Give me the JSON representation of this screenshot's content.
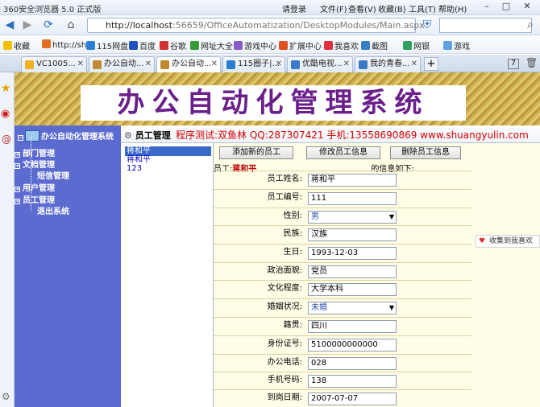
{
  "browser": {
    "title": "360安全浏览器 5.0 正式版",
    "login": "请登录",
    "menus": [
      "文件(F)",
      "查看(V)",
      "收藏(B)",
      "工具(T)",
      "帮助(H)"
    ],
    "url_host": "http://localhost",
    "url_rest": ":56659/OfficeAutomatization/DesktopModules/Main.aspx",
    "bookmarks": [
      "收藏",
      "http://sh",
      "115网盘",
      "百度",
      "谷歌",
      "网址大全",
      "游戏中心",
      "扩展中心",
      "我喜欢",
      "截图",
      "网银",
      "游戏"
    ],
    "tabs": [
      "VC1005...",
      "办公自动...",
      "办公自动...",
      "115圈子|...",
      "优酷电视...",
      "我的青春..."
    ],
    "active_tab": 2,
    "new_tab": "+",
    "tab_count": "7",
    "fav_tip": "收集到我喜欢"
  },
  "banner": {
    "title": "办公自动化管理系统"
  },
  "nav": {
    "root": "办公自动化管理系统",
    "items": [
      {
        "label": "部门管理",
        "expand": "+"
      },
      {
        "label": "文档管理",
        "expand": "+"
      },
      {
        "label": "短信管理",
        "expand": ""
      },
      {
        "label": "用户管理",
        "expand": "+"
      },
      {
        "label": "员工管理",
        "expand": "+"
      },
      {
        "label": "退出系统",
        "expand": ""
      }
    ]
  },
  "header": {
    "section": "员工管理",
    "promo": "程序测试:双鱼林 QQ:287307421 手机:13558690869 www.shuangyulin.com"
  },
  "employees": [
    "蒋和平",
    "蒋和平",
    "123"
  ],
  "selected_employee": 0,
  "actions": {
    "add": "添加新的员工",
    "edit": "修改员工信息",
    "delete": "删除员工信息"
  },
  "caption": {
    "prefix": "员工:",
    "name": "蒋和平",
    "suffix": "的信息如下:"
  },
  "form": [
    {
      "label": "员工姓名:",
      "value": "蒋和平",
      "type": "text"
    },
    {
      "label": "员工编号:",
      "value": "111",
      "type": "text"
    },
    {
      "label": "性别:",
      "value": "男",
      "type": "select"
    },
    {
      "label": "民族:",
      "value": "汉族",
      "type": "text"
    },
    {
      "label": "生日:",
      "value": "1993-12-03",
      "type": "text"
    },
    {
      "label": "政治面貌:",
      "value": "党员",
      "type": "text"
    },
    {
      "label": "文化程度:",
      "value": "大学本科",
      "type": "text"
    },
    {
      "label": "婚姻状况:",
      "value": "未婚",
      "type": "select"
    },
    {
      "label": "籍贯:",
      "value": "四川",
      "type": "text"
    },
    {
      "label": "身份证号:",
      "value": "5100000000000",
      "type": "text"
    },
    {
      "label": "办公电话:",
      "value": "028",
      "type": "text"
    },
    {
      "label": "手机号码:",
      "value": "138",
      "type": "text"
    },
    {
      "label": "到岗日期:",
      "value": "2007-07-07",
      "type": "text"
    }
  ]
}
